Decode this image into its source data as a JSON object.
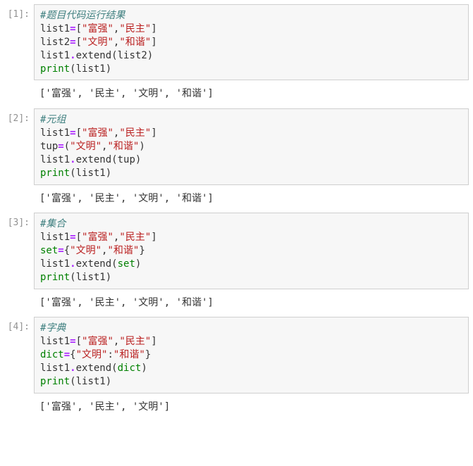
{
  "cells": [
    {
      "prompt": "[1]:",
      "code": [
        [
          [
            "cmt",
            "#题目代码运行结果"
          ]
        ],
        [
          [
            "id",
            "list1"
          ],
          [
            "op",
            "="
          ],
          [
            "pun",
            "["
          ],
          [
            "str",
            "\"富强\""
          ],
          [
            "pun",
            ","
          ],
          [
            "str",
            "\"民主\""
          ],
          [
            "pun",
            "]"
          ]
        ],
        [
          [
            "id",
            "list2"
          ],
          [
            "op",
            "="
          ],
          [
            "pun",
            "["
          ],
          [
            "str",
            "\"文明\""
          ],
          [
            "pun",
            ","
          ],
          [
            "str",
            "\"和谐\""
          ],
          [
            "pun",
            "]"
          ]
        ],
        [
          [
            "id",
            "list1"
          ],
          [
            "op",
            "."
          ],
          [
            "id",
            "extend"
          ],
          [
            "pun",
            "("
          ],
          [
            "id",
            "list2"
          ],
          [
            "pun",
            ")"
          ]
        ],
        [
          [
            "fn",
            "print"
          ],
          [
            "pun",
            "("
          ],
          [
            "id",
            "list1"
          ],
          [
            "pun",
            ")"
          ]
        ]
      ],
      "output": "['富强', '民主', '文明', '和谐']"
    },
    {
      "prompt": "[2]:",
      "code": [
        [
          [
            "cmt",
            "#元组"
          ]
        ],
        [
          [
            "id",
            "list1"
          ],
          [
            "op",
            "="
          ],
          [
            "pun",
            "["
          ],
          [
            "str",
            "\"富强\""
          ],
          [
            "pun",
            ","
          ],
          [
            "str",
            "\"民主\""
          ],
          [
            "pun",
            "]"
          ]
        ],
        [
          [
            "id",
            "tup"
          ],
          [
            "op",
            "="
          ],
          [
            "pun",
            "("
          ],
          [
            "str",
            "\"文明\""
          ],
          [
            "pun",
            ","
          ],
          [
            "str",
            "\"和谐\""
          ],
          [
            "pun",
            ")"
          ]
        ],
        [
          [
            "id",
            "list1"
          ],
          [
            "op",
            "."
          ],
          [
            "id",
            "extend"
          ],
          [
            "pun",
            "("
          ],
          [
            "id",
            "tup"
          ],
          [
            "pun",
            ")"
          ]
        ],
        [
          [
            "fn",
            "print"
          ],
          [
            "pun",
            "("
          ],
          [
            "id",
            "list1"
          ],
          [
            "pun",
            ")"
          ]
        ]
      ],
      "output": "['富强', '民主', '文明', '和谐']"
    },
    {
      "prompt": "[3]:",
      "code": [
        [
          [
            "cmt",
            "#集合"
          ]
        ],
        [
          [
            "id",
            "list1"
          ],
          [
            "op",
            "="
          ],
          [
            "pun",
            "["
          ],
          [
            "str",
            "\"富强\""
          ],
          [
            "pun",
            ","
          ],
          [
            "str",
            "\"民主\""
          ],
          [
            "pun",
            "]"
          ]
        ],
        [
          [
            "fn",
            "set"
          ],
          [
            "op",
            "="
          ],
          [
            "pun",
            "{"
          ],
          [
            "str",
            "\"文明\""
          ],
          [
            "pun",
            ","
          ],
          [
            "str",
            "\"和谐\""
          ],
          [
            "pun",
            "}"
          ]
        ],
        [
          [
            "id",
            "list1"
          ],
          [
            "op",
            "."
          ],
          [
            "id",
            "extend"
          ],
          [
            "pun",
            "("
          ],
          [
            "fn",
            "set"
          ],
          [
            "pun",
            ")"
          ]
        ],
        [
          [
            "fn",
            "print"
          ],
          [
            "pun",
            "("
          ],
          [
            "id",
            "list1"
          ],
          [
            "pun",
            ")"
          ]
        ]
      ],
      "output": "['富强', '民主', '文明', '和谐']"
    },
    {
      "prompt": "[4]:",
      "code": [
        [
          [
            "cmt",
            "#字典"
          ]
        ],
        [
          [
            "id",
            "list1"
          ],
          [
            "op",
            "="
          ],
          [
            "pun",
            "["
          ],
          [
            "str",
            "\"富强\""
          ],
          [
            "pun",
            ","
          ],
          [
            "str",
            "\"民主\""
          ],
          [
            "pun",
            "]"
          ]
        ],
        [
          [
            "fn",
            "dict"
          ],
          [
            "op",
            "="
          ],
          [
            "pun",
            "{"
          ],
          [
            "str",
            "\"文明\""
          ],
          [
            "pun",
            ":"
          ],
          [
            "str",
            "\"和谐\""
          ],
          [
            "pun",
            "}"
          ]
        ],
        [
          [
            "id",
            "list1"
          ],
          [
            "op",
            "."
          ],
          [
            "id",
            "extend"
          ],
          [
            "pun",
            "("
          ],
          [
            "fn",
            "dict"
          ],
          [
            "pun",
            ")"
          ]
        ],
        [
          [
            "fn",
            "print"
          ],
          [
            "pun",
            "("
          ],
          [
            "id",
            "list1"
          ],
          [
            "pun",
            ")"
          ]
        ]
      ],
      "output": "['富强', '民主', '文明']"
    }
  ]
}
